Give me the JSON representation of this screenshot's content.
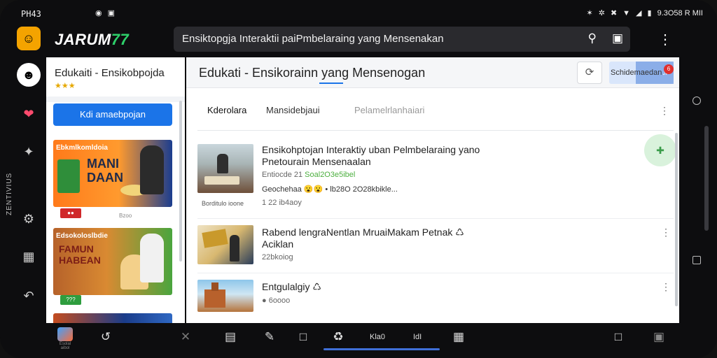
{
  "status_bar": {
    "time": "PH43",
    "right_text": "9.3O58 R MII",
    "signal_icons": [
      "bluetooth-icon",
      "mute-icon",
      "wifi-icon",
      "signal-icon",
      "battery-icon"
    ]
  },
  "rail": {
    "vertical_text": "ZENTIVIUS"
  },
  "app_bar": {
    "brand_text": "JARUM",
    "brand_number": "77",
    "search_value": "Ensiktopgja Interaktii paiPmbelaraing yang   Mensenakan"
  },
  "left_panel": {
    "title": "Edukaiti - Ensikobpojda",
    "stars": "★★★",
    "cta_label": "Kdi amaebpojan",
    "cards": [
      {
        "caption": "Ebkmlkomldoia",
        "headline": "MANI\nDAAN",
        "label": "Bzoo"
      },
      {
        "caption": "Edsokoloslbdie",
        "headline": "FAMUN\nHABEAN",
        "label": "???"
      },
      {
        "caption": "",
        "headline": "",
        "label": ""
      }
    ]
  },
  "main_panel": {
    "title": "Edukati - Ensikorainn yang Mensenogan",
    "notify_label": "Schidemaedan",
    "notify_count": "6",
    "tabs": [
      {
        "label": "Kderolara",
        "active": true
      },
      {
        "label": "Mansidebjaui",
        "active": false
      },
      {
        "label": "Pelamelrlanhaiari",
        "active": false
      }
    ],
    "rows": [
      {
        "title": "Ensikohptojan Interaktiy uban Pelmbelaraing yano",
        "title2": "Pnetourain Mensenaalan",
        "meta1": "Entiocde 21",
        "meta1_green": "Soal2O3e5ibel",
        "meta2": "Geochehaa 😮😮 • lb28O 2O28kbikle...",
        "meta3": "1 22 ib4aoy",
        "thumb_caption": "Borditulo ioone"
      },
      {
        "title": "Rabend lengraNentlan MruaiMakam Petnak ♺",
        "title2": "Aciklan",
        "meta1": "22bkoiog"
      },
      {
        "title": "Entgulalgiy ♺",
        "meta1": "● 6oooo"
      }
    ],
    "fab_icon": "add-icon"
  },
  "bottom_bar": {
    "app_label": "Esolal aibol",
    "items": [
      "Kla0",
      "IdI"
    ]
  },
  "colors": {
    "accent_blue": "#1b74e8",
    "brand_green": "#2ed06a",
    "notify_red": "#e0302e"
  }
}
